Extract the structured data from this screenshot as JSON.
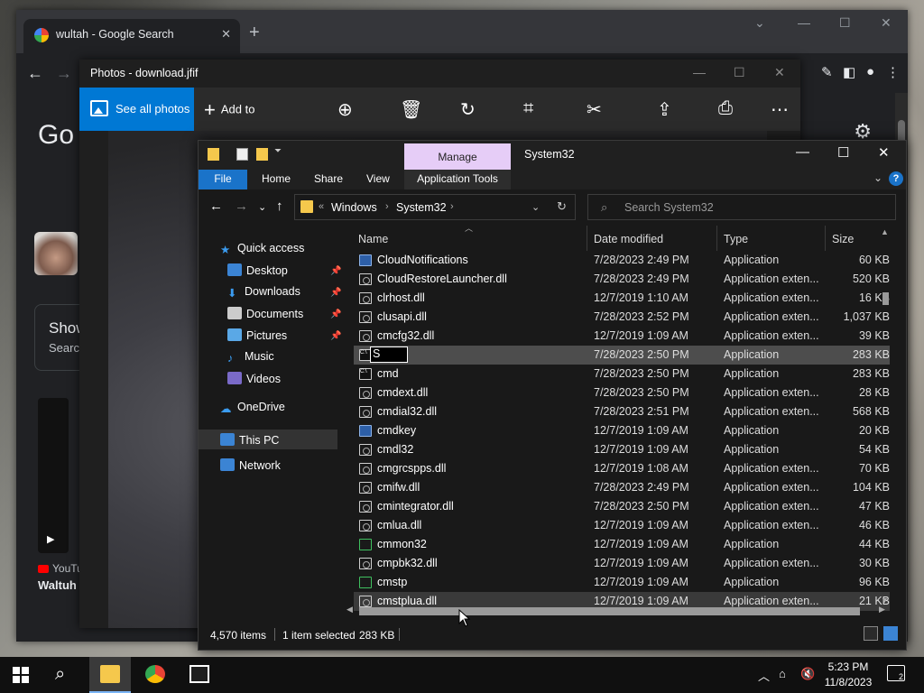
{
  "chrome": {
    "tab_title": "wultah - Google Search",
    "tab_close": "✕",
    "new_tab": "+",
    "google_logo": "Go",
    "card_title": "Show",
    "card_sub": "Searc",
    "video_source": "YouTu",
    "video_title": "Waltuh"
  },
  "photos": {
    "title": "Photos - download.jfif",
    "see_all": "See all photos",
    "add_to": "Add to"
  },
  "explorer": {
    "title": "System32",
    "manage_tab": "Manage",
    "ribbon_tabs": [
      "File",
      "Home",
      "Share",
      "View"
    ],
    "app_tools": "Application Tools",
    "help": "?",
    "address": [
      "«",
      "Windows",
      "System32"
    ],
    "search_placeholder": "Search System32",
    "columns": {
      "name": "Name",
      "date": "Date modified",
      "type": "Type",
      "size": "Size"
    },
    "nav": {
      "quick_access": "Quick access",
      "desktop": "Desktop",
      "downloads": "Downloads",
      "documents": "Documents",
      "pictures": "Pictures",
      "music": "Music",
      "videos": "Videos",
      "onedrive": "OneDrive",
      "thispc": "This PC",
      "network": "Network"
    },
    "rename_value": "S",
    "files": [
      {
        "name": "CloudNotifications",
        "date": "7/28/2023 2:49 PM",
        "type": "Application",
        "size": "60 KB",
        "icon": "app"
      },
      {
        "name": "CloudRestoreLauncher.dll",
        "date": "7/28/2023 2:49 PM",
        "type": "Application exten...",
        "size": "520 KB",
        "icon": "dll"
      },
      {
        "name": "clrhost.dll",
        "date": "12/7/2019 1:10 AM",
        "type": "Application exten...",
        "size": "16 KB",
        "icon": "dll"
      },
      {
        "name": "clusapi.dll",
        "date": "7/28/2023 2:52 PM",
        "type": "Application exten...",
        "size": "1,037 KB",
        "icon": "dll"
      },
      {
        "name": "cmcfg32.dll",
        "date": "12/7/2019 1:09 AM",
        "type": "Application exten...",
        "size": "39 KB",
        "icon": "dll"
      },
      {
        "name": "",
        "date": "7/28/2023 2:50 PM",
        "type": "Application",
        "size": "283 KB",
        "icon": "cmd"
      },
      {
        "name": "cmd",
        "date": "7/28/2023 2:50 PM",
        "type": "Application",
        "size": "283 KB",
        "icon": "cmd"
      },
      {
        "name": "cmdext.dll",
        "date": "7/28/2023 2:50 PM",
        "type": "Application exten...",
        "size": "28 KB",
        "icon": "dll"
      },
      {
        "name": "cmdial32.dll",
        "date": "7/28/2023 2:51 PM",
        "type": "Application exten...",
        "size": "568 KB",
        "icon": "dll"
      },
      {
        "name": "cmdkey",
        "date": "12/7/2019 1:09 AM",
        "type": "Application",
        "size": "20 KB",
        "icon": "app"
      },
      {
        "name": "cmdl32",
        "date": "12/7/2019 1:09 AM",
        "type": "Application",
        "size": "54 KB",
        "icon": "dll"
      },
      {
        "name": "cmgrcspps.dll",
        "date": "12/7/2019 1:08 AM",
        "type": "Application exten...",
        "size": "70 KB",
        "icon": "dll"
      },
      {
        "name": "cmifw.dll",
        "date": "7/28/2023 2:49 PM",
        "type": "Application exten...",
        "size": "104 KB",
        "icon": "dll"
      },
      {
        "name": "cmintegrator.dll",
        "date": "7/28/2023 2:50 PM",
        "type": "Application exten...",
        "size": "47 KB",
        "icon": "dll"
      },
      {
        "name": "cmlua.dll",
        "date": "12/7/2019 1:09 AM",
        "type": "Application exten...",
        "size": "46 KB",
        "icon": "dll"
      },
      {
        "name": "cmmon32",
        "date": "12/7/2019 1:09 AM",
        "type": "Application",
        "size": "44 KB",
        "icon": "green"
      },
      {
        "name": "cmpbk32.dll",
        "date": "12/7/2019 1:09 AM",
        "type": "Application exten...",
        "size": "30 KB",
        "icon": "dll"
      },
      {
        "name": "cmstp",
        "date": "12/7/2019 1:09 AM",
        "type": "Application",
        "size": "96 KB",
        "icon": "green"
      },
      {
        "name": "cmstplua.dll",
        "date": "12/7/2019 1:09 AM",
        "type": "Application exten...",
        "size": "21 KB",
        "icon": "dll"
      }
    ],
    "status": {
      "items": "4,570 items",
      "selected": "1 item selected",
      "size": "283 KB"
    }
  },
  "taskbar": {
    "time": "5:23 PM",
    "date": "11/8/2023",
    "notification_count": "2"
  },
  "colors": {
    "accent": "#0078d4",
    "manage_tab": "#e6cdf7",
    "file_tab": "#1a73c9"
  }
}
